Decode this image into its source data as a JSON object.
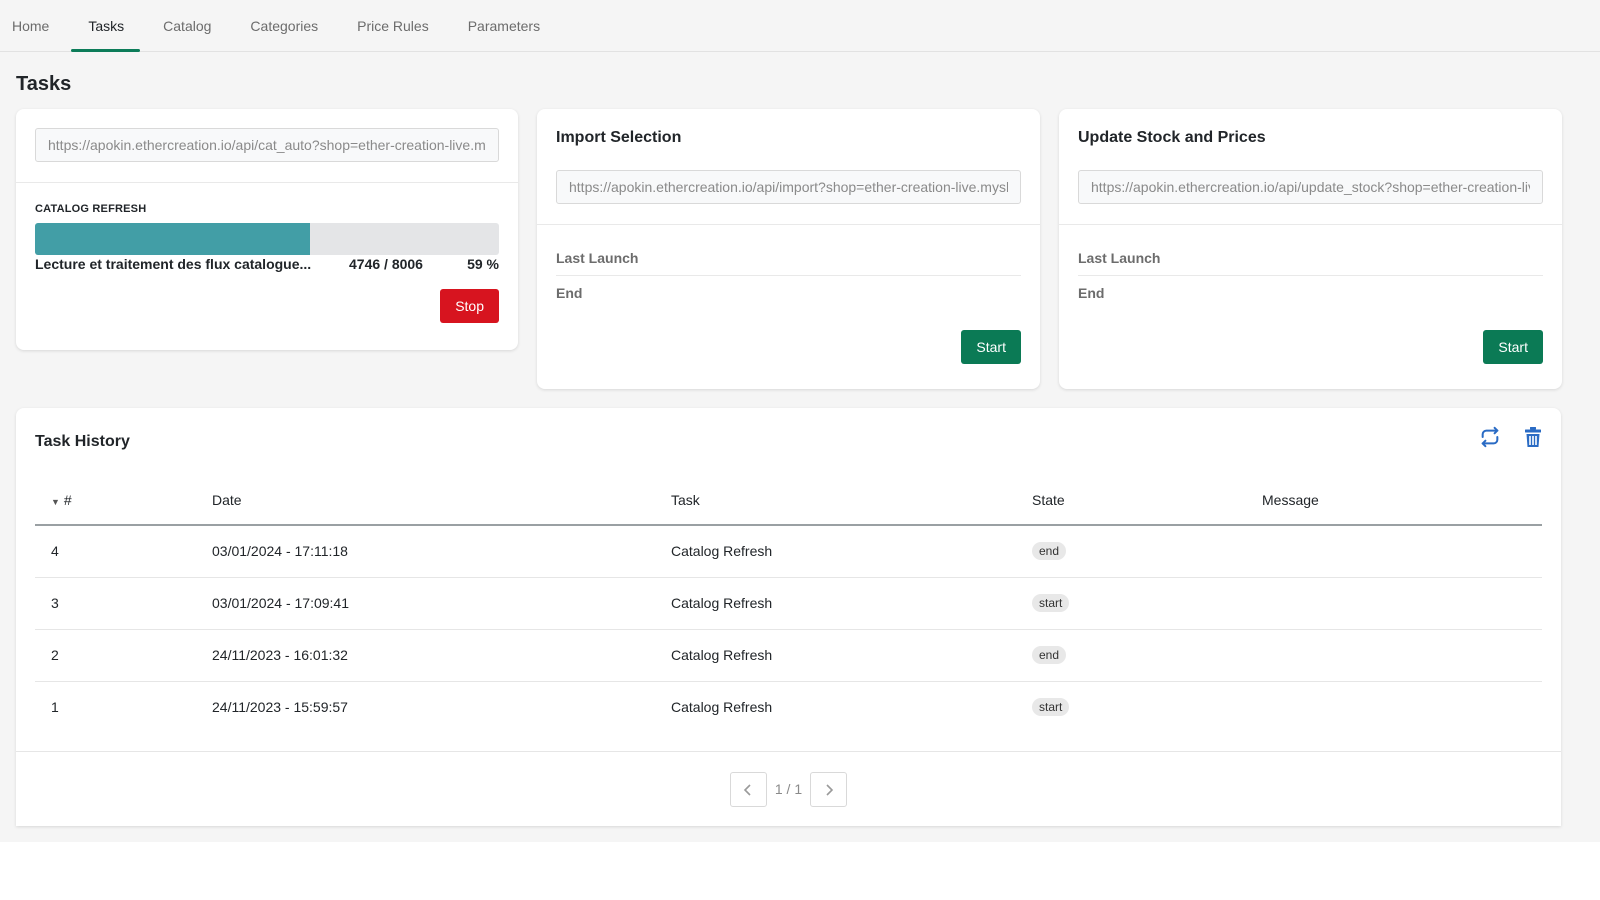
{
  "nav": {
    "tabs": [
      {
        "label": "Home",
        "active": false
      },
      {
        "label": "Tasks",
        "active": true
      },
      {
        "label": "Catalog",
        "active": false
      },
      {
        "label": "Categories",
        "active": false
      },
      {
        "label": "Price Rules",
        "active": false
      },
      {
        "label": "Parameters",
        "active": false
      }
    ]
  },
  "page": {
    "title": "Tasks"
  },
  "colors": {
    "accent": "#0c7c59",
    "progress": "#429ea6",
    "danger": "#d7141f",
    "success": "#0b7a55"
  },
  "catalog_card": {
    "url_placeholder": "https://apokin.ethercreation.io/api/cat_auto?shop=ether-creation-live.myshopify.com",
    "section_label": "CATALOG REFRESH",
    "progress": {
      "message": "Lecture et traitement des flux catalogue...",
      "current": 4746,
      "total": 8006,
      "count_text": "4746 / 8006",
      "percent": 59,
      "percent_text": "59 %"
    },
    "stop_label": "Stop"
  },
  "import_card": {
    "title": "Import Selection",
    "url_placeholder": "https://apokin.ethercreation.io/api/import?shop=ether-creation-live.myshopify.com",
    "last_launch_label": "Last Launch",
    "end_label": "End",
    "start_label": "Start"
  },
  "update_card": {
    "title": "Update Stock and Prices",
    "url_placeholder": "https://apokin.ethercreation.io/api/update_stock?shop=ether-creation-live.myshopify.com",
    "last_launch_label": "Last Launch",
    "end_label": "End",
    "start_label": "Start"
  },
  "history": {
    "title": "Task History",
    "icons": {
      "refresh": "refresh-icon",
      "delete": "trash-icon"
    },
    "columns": [
      "#",
      "Date",
      "Task",
      "State",
      "Message"
    ],
    "sort_indicator": "▼",
    "rows": [
      {
        "num": "4",
        "date": "03/01/2024 - 17:11:18",
        "task": "Catalog Refresh",
        "state": "end",
        "message": ""
      },
      {
        "num": "3",
        "date": "03/01/2024 - 17:09:41",
        "task": "Catalog Refresh",
        "state": "start",
        "message": ""
      },
      {
        "num": "2",
        "date": "24/11/2023 - 16:01:32",
        "task": "Catalog Refresh",
        "state": "end",
        "message": ""
      },
      {
        "num": "1",
        "date": "24/11/2023 - 15:59:57",
        "task": "Catalog Refresh",
        "state": "start",
        "message": ""
      }
    ],
    "pagination": {
      "text": "1 / 1",
      "prev_icon": "chevron-left-icon",
      "next_icon": "chevron-right-icon"
    }
  }
}
